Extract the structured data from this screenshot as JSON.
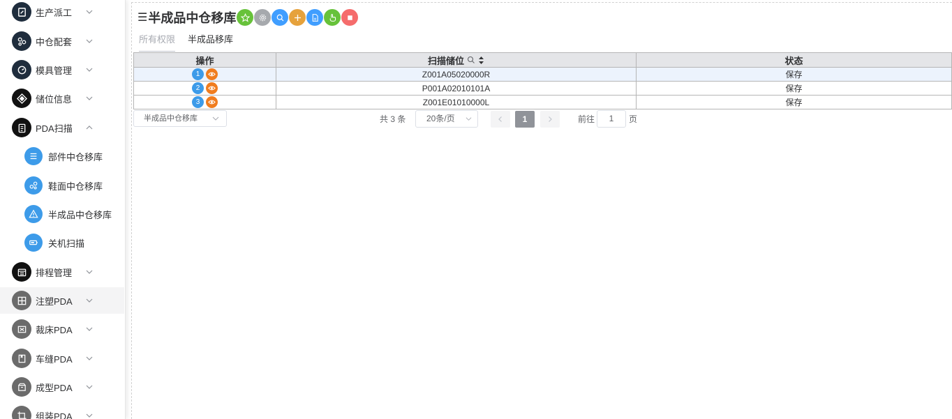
{
  "sidebar": {
    "items": [
      {
        "label": "生产派工",
        "icon": "edit-doc-icon",
        "arrow": "down"
      },
      {
        "label": "中仓配套",
        "icon": "share-nodes-icon",
        "arrow": "down"
      },
      {
        "label": "模具管理",
        "icon": "gauge-icon",
        "arrow": "down"
      },
      {
        "label": "储位信息",
        "icon": "diamond-grid-icon",
        "arrow": "down"
      },
      {
        "label": "PDA扫描",
        "icon": "clipboard-icon",
        "arrow": "up"
      },
      {
        "label": "排程管理",
        "icon": "calendar-icon",
        "arrow": "down"
      },
      {
        "label": "注塑PDA",
        "icon": "grid-icon",
        "arrow": "down"
      },
      {
        "label": "裁床PDA",
        "icon": "cut-icon",
        "arrow": "down"
      },
      {
        "label": "车缝PDA",
        "icon": "bookmark-icon",
        "arrow": "down"
      },
      {
        "label": "成型PDA",
        "icon": "box-icon",
        "arrow": "down"
      },
      {
        "label": "组装PDA",
        "icon": "crop-icon",
        "arrow": "down"
      }
    ],
    "sub_items": [
      {
        "label": "部件中仓移库",
        "icon": "list-icon"
      },
      {
        "label": "鞋面中仓移库",
        "icon": "share-nodes-icon"
      },
      {
        "label": "半成品中仓移库",
        "icon": "warning-icon"
      },
      {
        "label": "关机扫描",
        "icon": "battery-icon"
      }
    ]
  },
  "header": {
    "title": "半成品中仓移库",
    "toolbar": [
      {
        "name": "favorite-button",
        "icon": "star-icon",
        "color": "#67c23a"
      },
      {
        "name": "settings-button",
        "icon": "gear-icon",
        "color": "#a6a9ad"
      },
      {
        "name": "search-button",
        "icon": "search-icon",
        "color": "#409eff"
      },
      {
        "name": "add-button",
        "icon": "plus-icon",
        "color": "#e6a23c"
      },
      {
        "name": "document-button",
        "icon": "document-icon",
        "color": "#409eff"
      },
      {
        "name": "hand-button",
        "icon": "hand-icon",
        "color": "#67c23a"
      },
      {
        "name": "stop-button",
        "icon": "stop-icon",
        "color": "#f56c6c"
      }
    ]
  },
  "tabs": [
    "所有权限",
    "半成品移库"
  ],
  "table": {
    "columns": [
      "操作",
      "扫描储位",
      "状态"
    ],
    "rows": [
      {
        "index": "1",
        "location": "Z001A05020000R",
        "status": "保存"
      },
      {
        "index": "2",
        "location": "P001A02010101A",
        "status": "保存"
      },
      {
        "index": "3",
        "location": "Z001E01010000L",
        "status": "保存"
      }
    ]
  },
  "pager": {
    "view_select": "半成品中仓移库",
    "total": "共 3 条",
    "page_size": "20条/页",
    "current_page": "1",
    "goto_label": "前往",
    "goto_value": "1",
    "page_unit": "页"
  }
}
